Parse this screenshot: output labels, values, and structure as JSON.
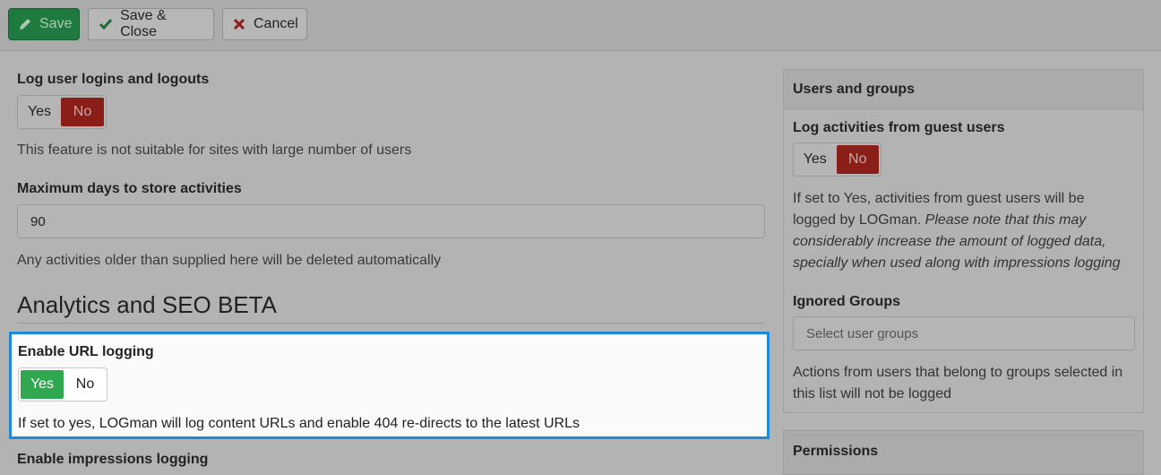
{
  "toolbar": {
    "save_label": "Save",
    "save_close_label": "Save & Close",
    "cancel_label": "Cancel"
  },
  "main": {
    "log_logins": {
      "label": "Log user logins and logouts",
      "yes": "Yes",
      "no": "No",
      "selected": "No",
      "help": "This feature is not suitable for sites with large number of users"
    },
    "max_days": {
      "label": "Maximum days to store activities",
      "value": "90",
      "help": "Any activities older than supplied here will be deleted automatically"
    },
    "analytics_heading": "Analytics and SEO BETA",
    "url_logging": {
      "label": "Enable URL logging",
      "yes": "Yes",
      "no": "No",
      "selected": "Yes",
      "help": "If set to yes, LOGman will log content URLs and enable 404 re-directs to the latest URLs"
    },
    "impressions_label": "Enable impressions logging"
  },
  "sidebar": {
    "users_groups": {
      "title": "Users and groups",
      "guest": {
        "label": "Log activities from guest users",
        "yes": "Yes",
        "no": "No",
        "selected": "No",
        "help_line1": "If set to Yes, activities from guest users will be",
        "help_line2_plain": "logged by LOGman. ",
        "help_line2_italic": "Please note that this may",
        "help_line3": "considerably increase the amount of logged data,",
        "help_line4": "specially when used along with impressions logging"
      },
      "ignored": {
        "label": "Ignored Groups",
        "placeholder": "Select user groups",
        "help_line1": "Actions from users that belong to groups selected in",
        "help_line2": "this list will not be logged"
      }
    },
    "permissions": {
      "title": "Permissions"
    }
  },
  "colors": {
    "save_green": "#2fa84f",
    "no_red": "#8a1e18",
    "highlight_border": "#1a8ad9"
  }
}
